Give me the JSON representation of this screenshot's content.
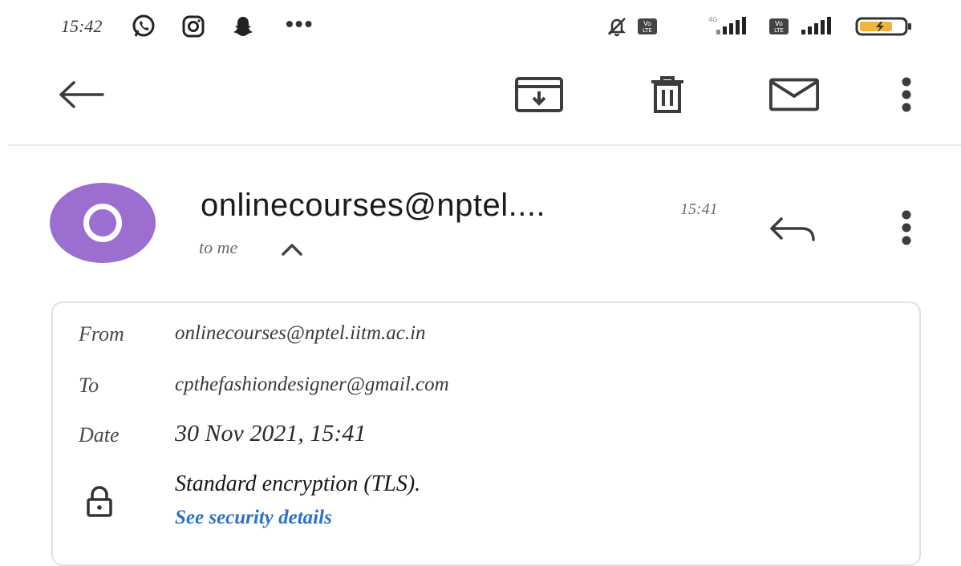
{
  "status_bar": {
    "time": "15:42",
    "more": "•••"
  },
  "email": {
    "sender_display": "onlinecourses@nptel....",
    "time": "15:41",
    "to_me": "to me"
  },
  "details": {
    "from_label": "From",
    "from_value": "onlinecourses@nptel.iitm.ac.in",
    "to_label": "To",
    "to_value": "cpthefashiondesigner@gmail.com",
    "date_label": "Date",
    "date_value": "30 Nov 2021, 15:41",
    "encryption_text": "Standard encryption (TLS).",
    "security_link": "See security details"
  },
  "colors": {
    "avatar": "#9c6ed0",
    "link": "#2f6fc8"
  }
}
